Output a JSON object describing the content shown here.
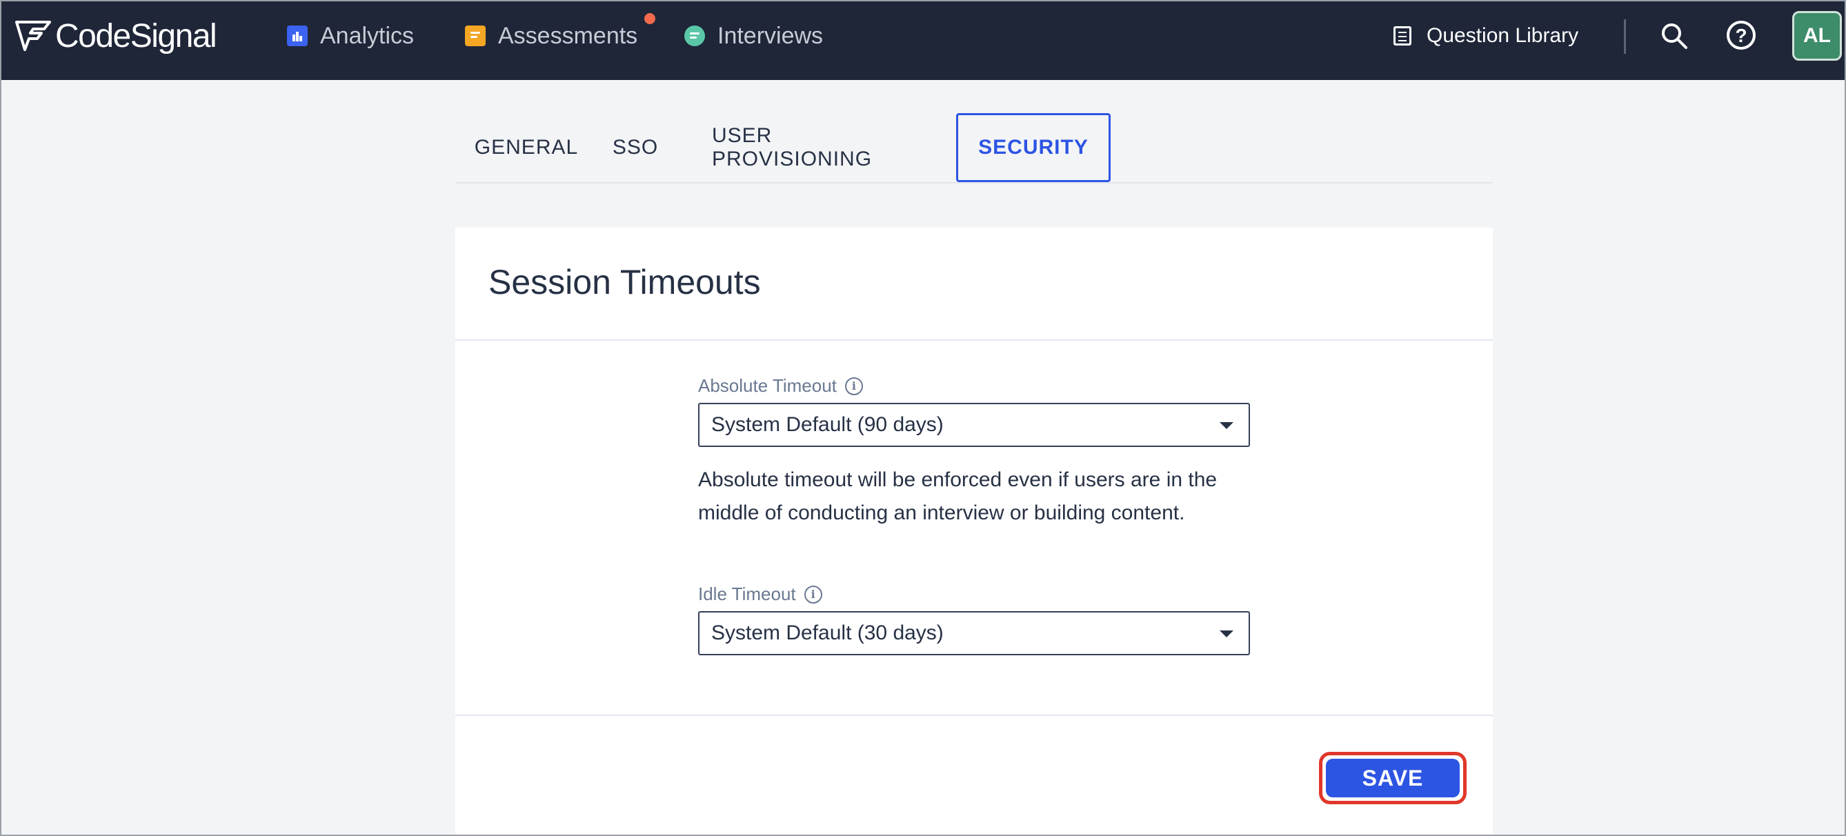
{
  "app": {
    "brand": "CodeSignal"
  },
  "nav": {
    "items": [
      {
        "label": "Analytics",
        "icon": "analytics-icon"
      },
      {
        "label": "Assessments",
        "icon": "assessments-icon",
        "has_notification": true
      },
      {
        "label": "Interviews",
        "icon": "interviews-icon"
      }
    ],
    "question_library": "Question Library",
    "help": "?",
    "avatar_initials": "AL"
  },
  "tabs": [
    {
      "label": "GENERAL",
      "active": false
    },
    {
      "label": "SSO",
      "active": false
    },
    {
      "label": "USER PROVISIONING",
      "active": false
    },
    {
      "label": "SECURITY",
      "active": true
    }
  ],
  "card": {
    "title": "Session Timeouts",
    "absolute_timeout": {
      "label": "Absolute Timeout",
      "value": "System Default (90 days)",
      "helper": "Absolute timeout will be enforced even if users are in the middle of conducting an interview or building content."
    },
    "idle_timeout": {
      "label": "Idle Timeout",
      "value": "System Default (30 days)"
    },
    "save_label": "SAVE"
  },
  "colors": {
    "topbar": "#1f2638",
    "accent": "#2d55e3",
    "highlight_ring": "#e0372a",
    "notification": "#f26b4f"
  }
}
